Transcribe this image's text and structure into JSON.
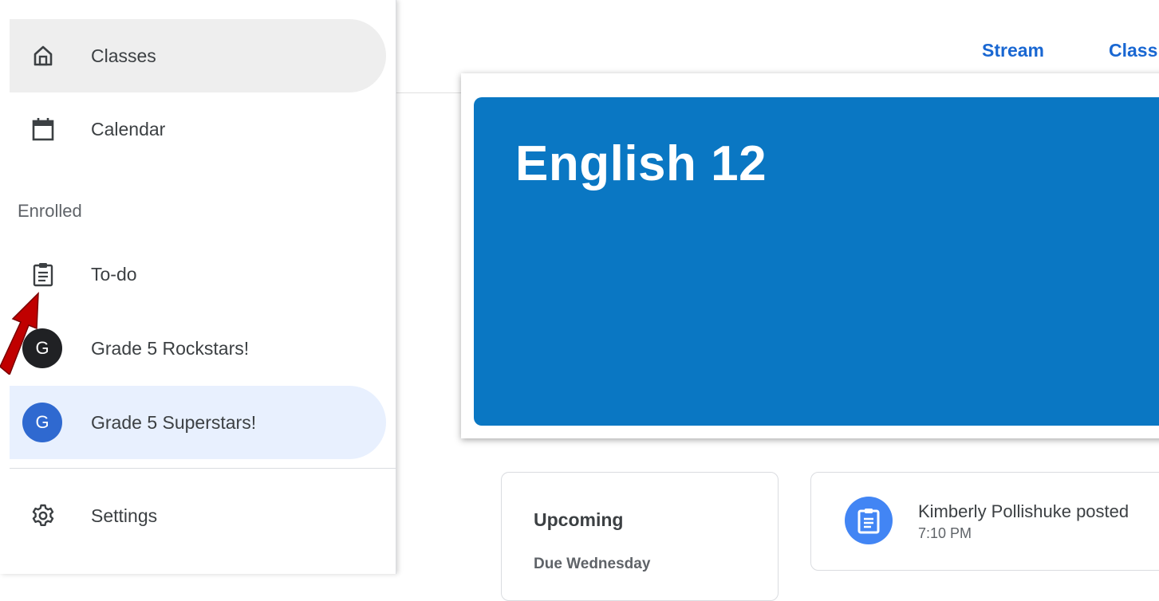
{
  "sidebar": {
    "items": [
      {
        "label": "Classes",
        "icon": "home-icon"
      },
      {
        "label": "Calendar",
        "icon": "calendar-icon"
      },
      {
        "label": "To-do",
        "icon": "assignment-icon"
      },
      {
        "label": "Grade 5 Rockstars!",
        "avatar": "G"
      },
      {
        "label": "Grade 5 Superstars!",
        "avatar": "G"
      },
      {
        "label": "Settings",
        "icon": "settings-icon"
      }
    ],
    "section_label": "Enrolled"
  },
  "topbar": {
    "tabs": [
      "Stream",
      "Class"
    ]
  },
  "banner": {
    "title": "English 12",
    "color": "#0a77c3"
  },
  "upcoming": {
    "title": "Upcoming",
    "due": "Due Wednesday"
  },
  "post": {
    "title": "Kimberly Pollishuke posted",
    "time": "7:10 PM"
  },
  "colors": {
    "accent": "#1967d2",
    "arrow": "#c00000",
    "selected_bg": "#e8f0fe"
  }
}
